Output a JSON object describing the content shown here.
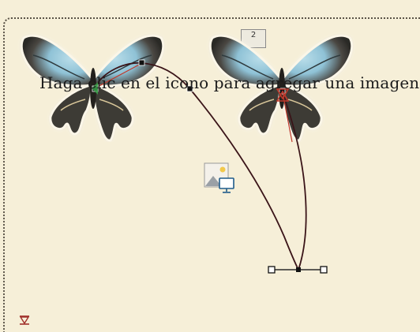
{
  "slide": {
    "prompt_text": "Haga clic en el icono para agregar una imagen",
    "sequence_badge": "2"
  },
  "icons": {
    "butterfly_left": "butterfly-image",
    "butterfly_right": "butterfly-image",
    "insert_picture": "insert-picture-icon",
    "motion_start": "motion-path-start-icon",
    "motion_end": "motion-path-end-icon"
  },
  "colors": {
    "background": "#f6efd8",
    "motion_path": "#3a1418",
    "motion_path_tangent": "#c0392b",
    "wing_blue": "#8fc2d6"
  }
}
